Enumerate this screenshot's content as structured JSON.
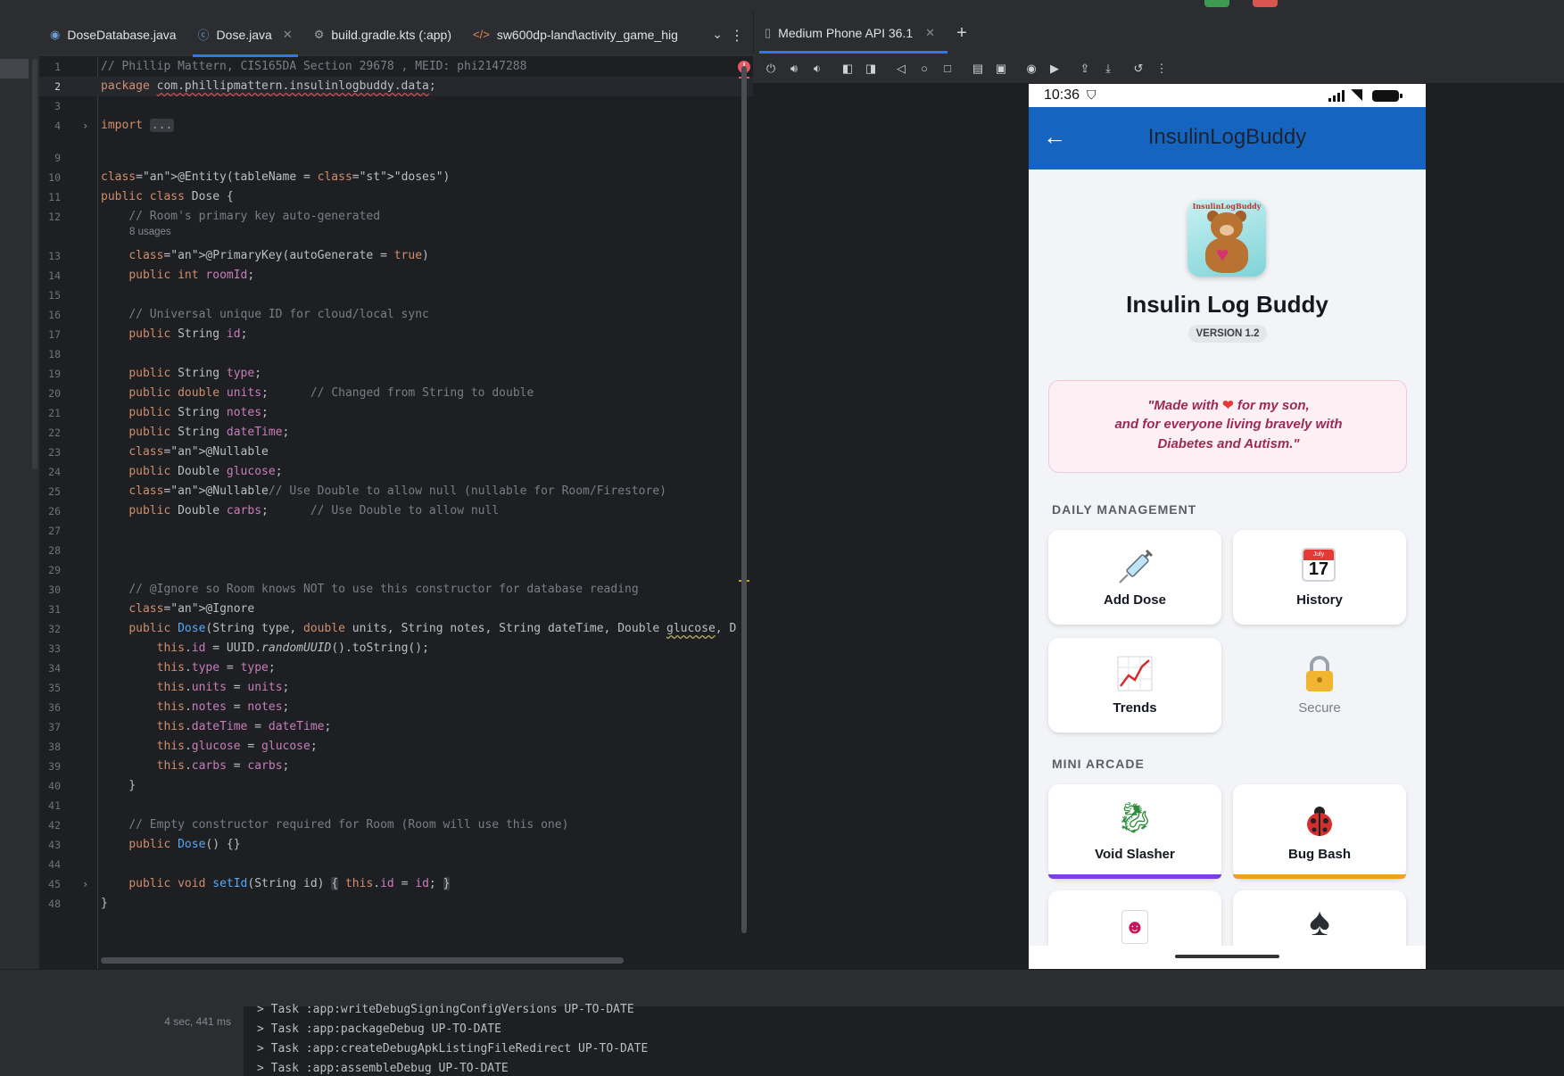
{
  "editor_tabs": [
    {
      "label": "DoseDatabase.java",
      "icon": "java-file-icon",
      "active": false
    },
    {
      "label": "Dose.java",
      "icon": "java-class-icon",
      "active": true
    },
    {
      "label": "build.gradle.kts (:app)",
      "icon": "gradle-icon",
      "active": false
    },
    {
      "label": "sw600dp-land\\activity_game_hig",
      "icon": "xml-icon",
      "active": false
    }
  ],
  "code": {
    "line_numbers": [
      "1",
      "2",
      "3",
      "4",
      "9",
      "10",
      "11",
      "12",
      "13",
      "14",
      "15",
      "16",
      "17",
      "18",
      "19",
      "20",
      "21",
      "22",
      "23",
      "24",
      "25",
      "26",
      "27",
      "28",
      "29",
      "30",
      "31",
      "32",
      "33",
      "34",
      "35",
      "36",
      "37",
      "38",
      "39",
      "40",
      "41",
      "42",
      "43",
      "44",
      "45",
      "48"
    ],
    "current_line": "2",
    "usages_hint": "8 usages",
    "lines": [
      "// Phillip Mattern, CIS165DA Section 29678 , MEID: phi2147288",
      "package com.phillipmattern.insulinlogbuddy.data;",
      "",
      "import ...",
      "",
      "@Entity(tableName = \"doses\")",
      "public class Dose {",
      "    // Room's primary key auto-generated",
      "    @PrimaryKey(autoGenerate = true)",
      "    public int roomId;",
      "",
      "    // Universal unique ID for cloud/local sync",
      "    public String id;",
      "",
      "    public String type;",
      "    public double units;      // Changed from String to double",
      "    public String notes;",
      "    public String dateTime;",
      "    @Nullable",
      "    public Double glucose;",
      "    @Nullable// Use Double to allow null (nullable for Room/Firestore)",
      "    public Double carbs;      // Use Double to allow null",
      "",
      "",
      "",
      "    // @Ignore so Room knows NOT to use this constructor for database reading",
      "    @Ignore",
      "    public Dose(String type, double units, String notes, String dateTime, Double glucose, D",
      "        this.id = UUID.randomUUID().toString();",
      "        this.type = type;",
      "        this.units = units;",
      "        this.notes = notes;",
      "        this.dateTime = dateTime;",
      "        this.glucose = glucose;",
      "        this.carbs = carbs;",
      "    }",
      "",
      "    // Empty constructor required for Room (Room will use this one)",
      "    public Dose() {}",
      "",
      "    public void setId(String id) { this.id = id; }",
      "}"
    ]
  },
  "emulator": {
    "tab_label": "Medium Phone API 36.1",
    "toolbar_icons": [
      "power-icon",
      "volume-up-icon",
      "volume-down-icon",
      "rotate-left-icon",
      "rotate-right-icon",
      "back-icon",
      "home-icon",
      "overview-icon",
      "fold-icon",
      "device-frame-icon",
      "screenshot-icon",
      "record-icon",
      "export-icon",
      "import-icon",
      "reset-icon",
      "more-icon"
    ]
  },
  "phone": {
    "status_time": "10:36",
    "appbar_title": "InsulinLogBuddy",
    "logo_text": "InsulinLogBuddy",
    "app_name": "Insulin Log Buddy",
    "version": "VERSION 1.2",
    "quote_line1_a": "\"Made with ",
    "quote_heart": "❤",
    "quote_line1_b": " for my son,",
    "quote_line2": "and for everyone living bravely with",
    "quote_line3": "Diabetes and Autism.\"",
    "daily_label": "DAILY MANAGEMENT",
    "arcade_label": "MINI ARCADE",
    "calendar_month": "July",
    "calendar_day": "17",
    "cards": {
      "add_dose": "Add Dose",
      "history": "History",
      "trends": "Trends",
      "secure": "Secure",
      "void_slasher": "Void Slasher",
      "bug_bash": "Bug Bash"
    },
    "colors": {
      "appbar": "#1565c0",
      "void_accent": "#7b3fe4",
      "bug_accent": "#f0a020"
    }
  },
  "build": {
    "elapsed": "4 sec, 441 ms",
    "log": [
      "> Task :app:writeDebugSigningConfigVersions UP-TO-DATE",
      "> Task :app:packageDebug UP-TO-DATE",
      "> Task :app:createDebugApkListingFileRedirect UP-TO-DATE",
      "> Task :app:assembleDebug UP-TO-DATE"
    ]
  }
}
